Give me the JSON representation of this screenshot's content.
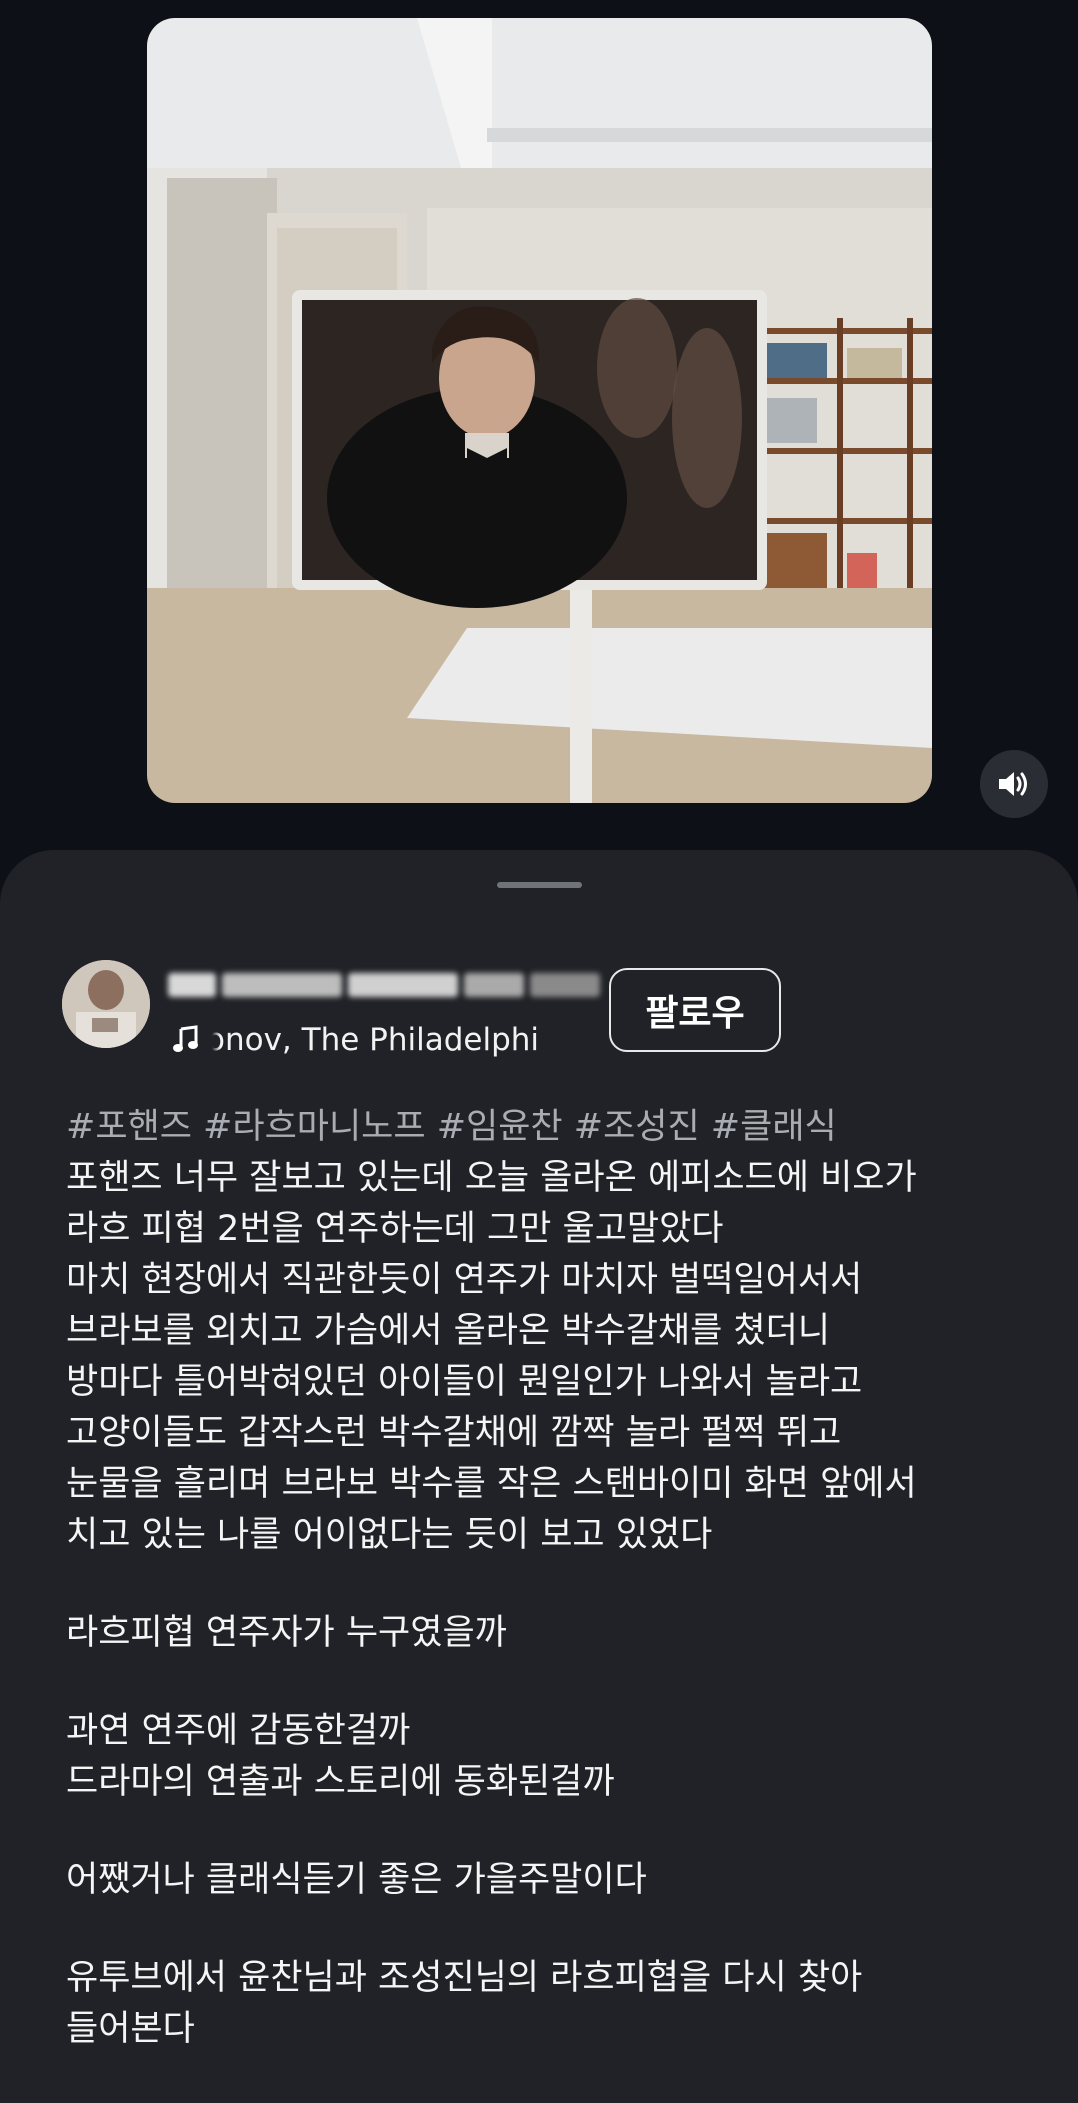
{
  "media": {
    "type": "photo",
    "description_icon": "image",
    "volume_icon": "speaker-on-icon"
  },
  "post": {
    "author": {
      "username": "j_a_ _a_g_ _ _",
      "avatar_icon": "profile-avatar"
    },
    "music": {
      "icon": "music-note-icon",
      "text": "onov, The Philadelphi"
    },
    "follow_label": "팔로우",
    "hashtags": "#포핸즈 #라흐마니노프 #임윤찬 #조성진 #클래식",
    "caption_lines": [
      "포핸즈 너무 잘보고 있는데 오늘 올라온 에피소드에 비오가",
      "라흐 피협 2번을 연주하는데 그만 울고말았다",
      "마치 현장에서 직관한듯이 연주가 마치자 벌떡일어서서",
      "브라보를 외치고 가슴에서 올라온 박수갈채를 쳤더니",
      "방마다 틀어박혀있던 아이들이 뭔일인가 나와서 놀라고",
      "고양이들도 갑작스런 박수갈채에 깜짝 놀라 펄쩍 뛰고",
      "눈물을 흘리며 브라보 박수를 작은 스탠바이미 화면 앞에서",
      "치고 있는 나를 어이없다는 듯이 보고 있었다",
      "",
      "라흐피협 연주자가 누구였을까",
      "",
      "과연 연주에 감동한걸까",
      "드라마의 연출과 스토리에 동화된걸까",
      "",
      "어쨌거나 클래식듣기 좋은 가을주말이다",
      "",
      "유투브에서 윤찬님과 조성진님의 라흐피협을 다시 찾아",
      "들어본다"
    ]
  },
  "colors": {
    "background": "#0d1117",
    "sheet": "#202227",
    "hashtag": "#a9adb3"
  }
}
